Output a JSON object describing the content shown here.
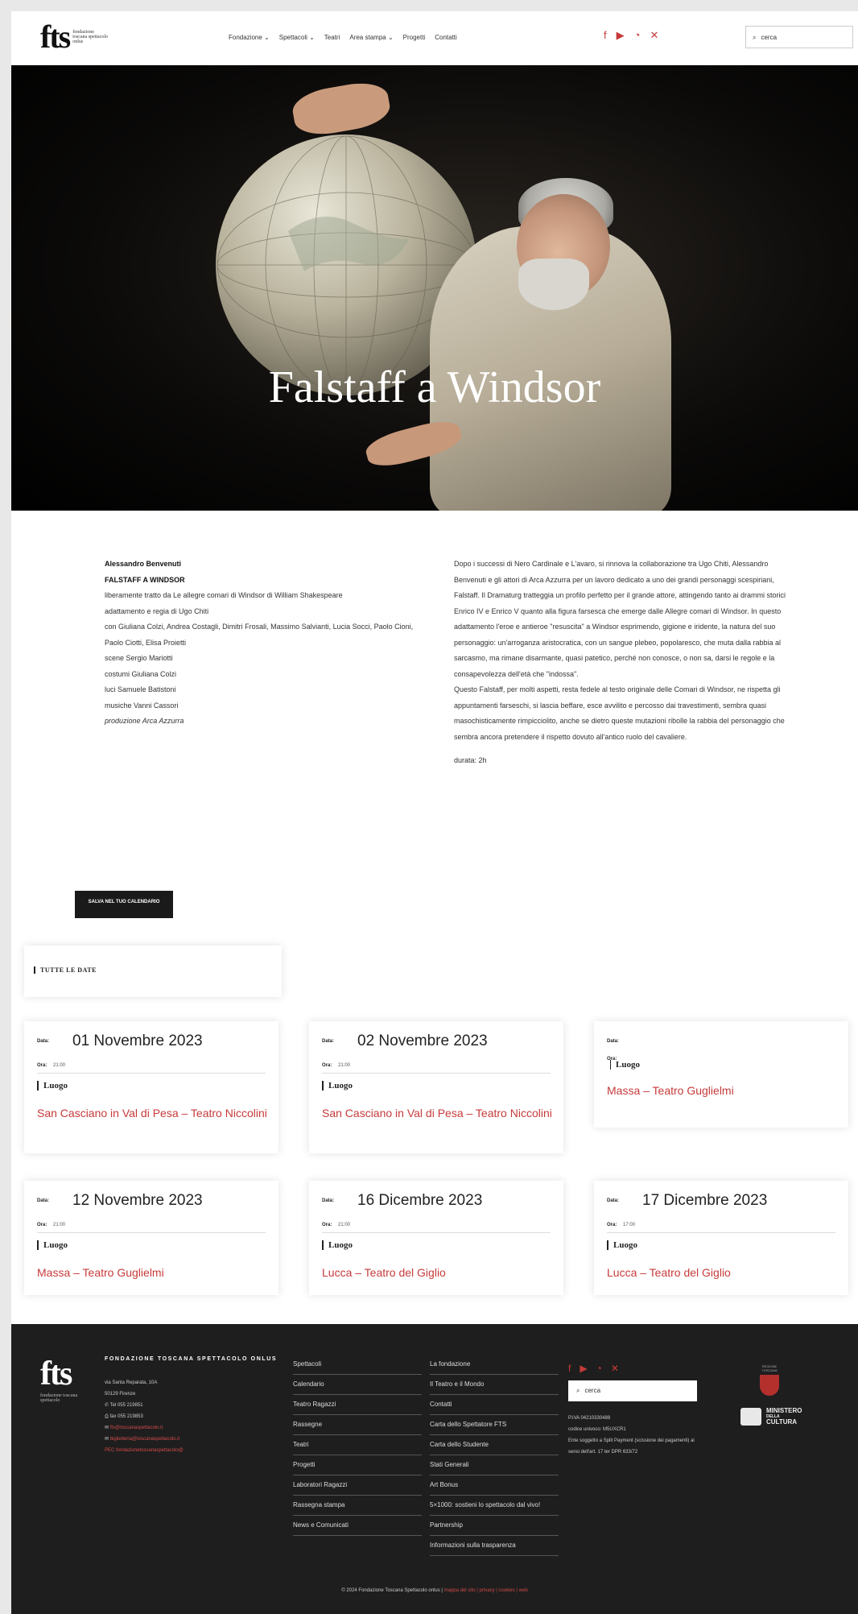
{
  "header": {
    "logo_mark": "fts",
    "logo_sub": "fondazione toscana spettacolo onlus",
    "nav": [
      "Fondazione ⌄",
      "Spettacoli ⌄",
      "Teatri",
      "Area stampa ⌄",
      "Progetti",
      "Contatti"
    ],
    "search_placeholder": "cerca"
  },
  "hero": {
    "title": "Falstaff a Windsor"
  },
  "credits": {
    "author": "Alessandro Benvenuti",
    "title": "FALSTAFF A WINDSOR",
    "lines": [
      "liberamente tratto da Le allegre comari di Windsor di William Shakespeare",
      "adattamento e regia di Ugo Chiti",
      "con Giuliana Colzi, Andrea Costagli, Dimitri Frosali, Massimo Salvianti, Lucia Socci, Paolo Cioni, Paolo Ciotti, Elisa Proietti",
      "scene Sergio Mariotti",
      "costumi Giuliana Colzi",
      "luci Samuele Batistoni",
      "musiche Vanni Cassori",
      "produzione Arca Azzurra"
    ]
  },
  "description": {
    "p1": "Dopo i successi di Nero Cardinale e L'avaro, si rinnova la collaborazione tra Ugo Chiti, Alessandro Benvenuti e gli attori di Arca Azzurra per un lavoro dedicato a uno dei grandi personaggi scespiriani, Falstaff. Il Dramaturg tratteggia un profilo perfetto per il grande attore, attingendo tanto ai drammi storici Enrico IV e Enrico V quanto alla figura farsesca che emerge dalle Allegre comari di Windsor. In questo adattamento l'eroe e antieroe \"resuscita\" a Windsor esprimendo, gigione e iridente, la natura del suo personaggio: un'arroganza aristocratica, con un sangue plebeo, popolaresco, che muta dalla rabbia al sarcasmo, ma rimane disarmante, quasi patetico, perché non conosce, o non sa, darsi le regole e la consapevolezza dell'età che \"indossa\".",
    "p2": "Questo Falstaff, per molti aspetti, resta fedele al testo originale delle Comari di Windsor, ne rispetta gli appuntamenti farseschi, si lascia beffare, esce avvilito e percosso dai travestimenti, sembra quasi masochisticamente rimpicciolito, anche se dietro queste mutazioni ribolle la rabbia del personaggio che sembra ancora pretendere il rispetto dovuto all'antico ruolo del cavaliere.",
    "duration": "durata: 2h"
  },
  "save_button": "SALVA NEL TUO CALENDARIO",
  "all_dates": "TUTTE LE DATE",
  "labels": {
    "date": "Data:",
    "time": "Ora:",
    "place": "Luogo"
  },
  "dates": [
    {
      "date": "01 Novembre 2023",
      "time": "21:00",
      "venue": "San Casciano in Val di Pesa – Teatro Niccolini"
    },
    {
      "date": "02 Novembre 2023",
      "time": "21:00",
      "venue": "San Casciano in Val di Pesa – Teatro Niccolini"
    },
    {
      "date": "",
      "time": "",
      "venue": "Massa – Teatro Guglielmi"
    },
    {
      "date": "12 Novembre 2023",
      "time": "21:00",
      "venue": "Massa – Teatro Guglielmi"
    },
    {
      "date": "16 Dicembre 2023",
      "time": "21:00",
      "venue": "Lucca – Teatro del Giglio"
    },
    {
      "date": "17 Dicembre 2023",
      "time": "17:00",
      "venue": "Lucca – Teatro del Giglio"
    }
  ],
  "footer": {
    "logo_mark": "fts",
    "logo_sub": "fondazione toscana spettacolo",
    "org": "FONDAZIONE TOSCANA SPETTACOLO ONLUS",
    "address1": "via Santa Reparata, 10A",
    "address2": "50129 Firenze",
    "tel": "Tel 055 219851",
    "fax": "fax 055 219853",
    "email1": "fts@toscanaspettacolo.it",
    "email2": "biglietteria@toscanaspettacolo.it",
    "pec": "PEC fondazionetoscanaspettacolo@",
    "col1": [
      "Spettacoli",
      "Calendario",
      "Teatro Ragazzi",
      "Rassegne",
      "Teatri",
      "Progetti",
      "Laboratori Ragazzi",
      "Rassegna stampa",
      "News e Comunicati"
    ],
    "col2": [
      "La fondazione",
      "Il Teatro e il Mondo",
      "Contatti",
      "Carta dello Spettatore FTS",
      "Carta dello Studente",
      "Stati Generali",
      "Art Bonus",
      "5×1000: sostieni lo spettacolo dal vivo!",
      "Partnership",
      "Informazioni sulla trasparenza"
    ],
    "search_placeholder": "cerca",
    "vat": [
      "P.IVA 04210330488",
      "codice univoco: M5UXCR1",
      "Ente soggetto a Split Payment (scissione dei pagamenti) ai sensi dell'art. 17 ter DPR 633/72"
    ],
    "region": "REGIONE TOSCANA",
    "ministry": [
      "MINISTERO",
      "DELLA",
      "CULTURA"
    ],
    "copyright": "© 2024 Fondazione Toscana Spettacolo onlus |",
    "copyright_links": "mappa del sito | privacy | cookies | web"
  }
}
